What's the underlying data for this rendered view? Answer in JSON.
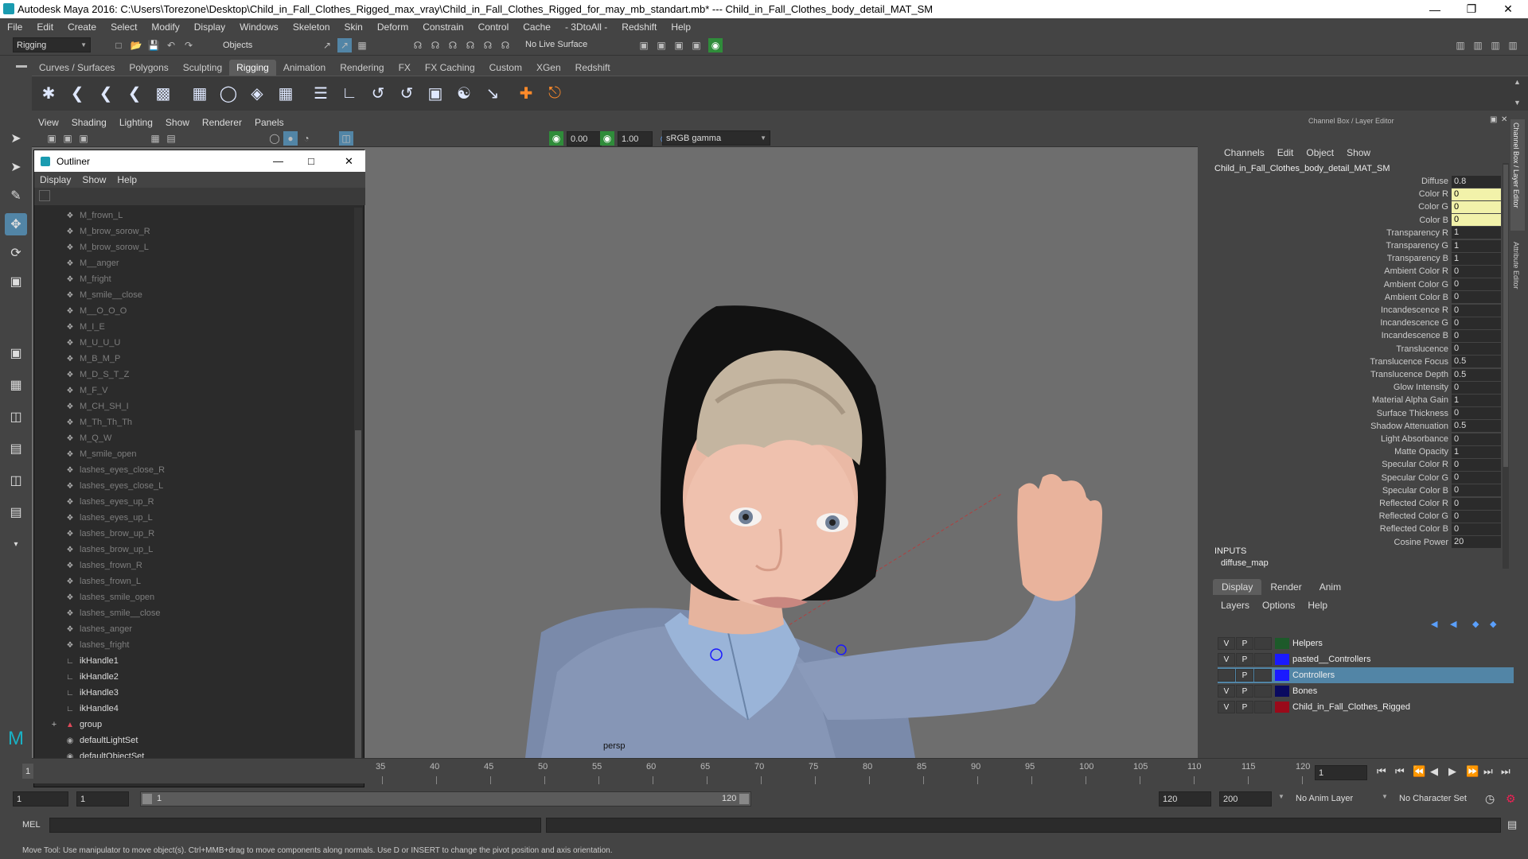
{
  "window": {
    "title": "Autodesk Maya 2016: C:\\Users\\Torezone\\Desktop\\Child_in_Fall_Clothes_Rigged_max_vray\\Child_in_Fall_Clothes_Rigged_for_may_mb_standart.mb*   ---   Child_in_Fall_Clothes_body_detail_MAT_SM"
  },
  "menubar": [
    "File",
    "Edit",
    "Create",
    "Select",
    "Modify",
    "Display",
    "Windows",
    "Skeleton",
    "Skin",
    "Deform",
    "Constrain",
    "Control",
    "Cache",
    "- 3DtoAll -",
    "Redshift",
    "Help"
  ],
  "statusline": {
    "menuset": "Rigging",
    "selmode": "Objects",
    "live_surface": "No Live Surface"
  },
  "shelf_tabs": [
    "Curves / Surfaces",
    "Polygons",
    "Sculpting",
    "Rigging",
    "Animation",
    "Rendering",
    "FX",
    "FX Caching",
    "Custom",
    "XGen",
    "Redshift"
  ],
  "shelf_active": "Rigging",
  "viewport": {
    "menu": [
      "View",
      "Shading",
      "Lighting",
      "Show",
      "Renderer",
      "Panels"
    ],
    "exposure": "0.00",
    "gamma": "1.00",
    "colorspace": "sRGB gamma",
    "camera_label": "persp"
  },
  "outliner": {
    "title": "Outliner",
    "menu": [
      "Display",
      "Show",
      "Help"
    ],
    "items": [
      {
        "label": "M_frown_L",
        "icon": "blendshape",
        "dim": true
      },
      {
        "label": "M_brow_sorow_R",
        "icon": "blendshape",
        "dim": true
      },
      {
        "label": "M_brow_sorow_L",
        "icon": "blendshape",
        "dim": true
      },
      {
        "label": "M__anger",
        "icon": "blendshape",
        "dim": true
      },
      {
        "label": "M_fright",
        "icon": "blendshape",
        "dim": true
      },
      {
        "label": "M_smile__close",
        "icon": "blendshape",
        "dim": true
      },
      {
        "label": "M__O_O_O",
        "icon": "blendshape",
        "dim": true
      },
      {
        "label": "M_I_E",
        "icon": "blendshape",
        "dim": true
      },
      {
        "label": "M_U_U_U",
        "icon": "blendshape",
        "dim": true
      },
      {
        "label": "M_B_M_P",
        "icon": "blendshape",
        "dim": true
      },
      {
        "label": "M_D_S_T_Z",
        "icon": "blendshape",
        "dim": true
      },
      {
        "label": "M_F_V",
        "icon": "blendshape",
        "dim": true
      },
      {
        "label": "M_CH_SH_I",
        "icon": "blendshape",
        "dim": true
      },
      {
        "label": "M_Th_Th_Th",
        "icon": "blendshape",
        "dim": true
      },
      {
        "label": "M_Q_W",
        "icon": "blendshape",
        "dim": true
      },
      {
        "label": "M_smile_open",
        "icon": "blendshape",
        "dim": true
      },
      {
        "label": "lashes_eyes_close_R",
        "icon": "blendshape",
        "dim": true
      },
      {
        "label": "lashes_eyes_close_L",
        "icon": "blendshape",
        "dim": true
      },
      {
        "label": "lashes_eyes_up_R",
        "icon": "blendshape",
        "dim": true
      },
      {
        "label": "lashes_eyes_up_L",
        "icon": "blendshape",
        "dim": true
      },
      {
        "label": "lashes_brow_up_R",
        "icon": "blendshape",
        "dim": true
      },
      {
        "label": "lashes_brow_up_L",
        "icon": "blendshape",
        "dim": true
      },
      {
        "label": "lashes_frown_R",
        "icon": "blendshape",
        "dim": true
      },
      {
        "label": "lashes_frown_L",
        "icon": "blendshape",
        "dim": true
      },
      {
        "label": "lashes_smile_open",
        "icon": "blendshape",
        "dim": true
      },
      {
        "label": "lashes_smile__close",
        "icon": "blendshape",
        "dim": true
      },
      {
        "label": "lashes_anger",
        "icon": "blendshape",
        "dim": true
      },
      {
        "label": "lashes_fright",
        "icon": "blendshape",
        "dim": true
      },
      {
        "label": "ikHandle1",
        "icon": "ikhandle",
        "dim": false
      },
      {
        "label": "ikHandle2",
        "icon": "ikhandle",
        "dim": false
      },
      {
        "label": "ikHandle3",
        "icon": "ikhandle",
        "dim": false
      },
      {
        "label": "ikHandle4",
        "icon": "ikhandle",
        "dim": false
      },
      {
        "label": "group",
        "icon": "group",
        "dim": false,
        "expandable": true
      },
      {
        "label": "defaultLightSet",
        "icon": "set",
        "dim": false
      },
      {
        "label": "defaultObjectSet",
        "icon": "set",
        "dim": false
      }
    ]
  },
  "channelbox": {
    "header": "Channel Box / Layer Editor",
    "menu": [
      "Channels",
      "Edit",
      "Object",
      "Show"
    ],
    "node": "Child_in_Fall_Clothes_body_detail_MAT_SM",
    "attributes": [
      {
        "name": "Diffuse",
        "value": "0.8",
        "hi": false
      },
      {
        "name": "Color R",
        "value": "0",
        "hi": true
      },
      {
        "name": "Color G",
        "value": "0",
        "hi": true
      },
      {
        "name": "Color B",
        "value": "0",
        "hi": true
      },
      {
        "name": "Transparency R",
        "value": "1",
        "hi": false
      },
      {
        "name": "Transparency G",
        "value": "1",
        "hi": false
      },
      {
        "name": "Transparency B",
        "value": "1",
        "hi": false
      },
      {
        "name": "Ambient Color R",
        "value": "0",
        "hi": false
      },
      {
        "name": "Ambient Color G",
        "value": "0",
        "hi": false
      },
      {
        "name": "Ambient Color B",
        "value": "0",
        "hi": false
      },
      {
        "name": "Incandescence R",
        "value": "0",
        "hi": false
      },
      {
        "name": "Incandescence G",
        "value": "0",
        "hi": false
      },
      {
        "name": "Incandescence B",
        "value": "0",
        "hi": false
      },
      {
        "name": "Translucence",
        "value": "0",
        "hi": false
      },
      {
        "name": "Translucence Focus",
        "value": "0.5",
        "hi": false
      },
      {
        "name": "Translucence Depth",
        "value": "0.5",
        "hi": false
      },
      {
        "name": "Glow Intensity",
        "value": "0",
        "hi": false
      },
      {
        "name": "Material Alpha Gain",
        "value": "1",
        "hi": false
      },
      {
        "name": "Surface Thickness",
        "value": "0",
        "hi": false
      },
      {
        "name": "Shadow Attenuation",
        "value": "0.5",
        "hi": false
      },
      {
        "name": "Light Absorbance",
        "value": "0",
        "hi": false
      },
      {
        "name": "Matte Opacity",
        "value": "1",
        "hi": false
      },
      {
        "name": "Specular Color R",
        "value": "0",
        "hi": false
      },
      {
        "name": "Specular Color G",
        "value": "0",
        "hi": false
      },
      {
        "name": "Specular Color B",
        "value": "0",
        "hi": false
      },
      {
        "name": "Reflected Color R",
        "value": "0",
        "hi": false
      },
      {
        "name": "Reflected Color G",
        "value": "0",
        "hi": false
      },
      {
        "name": "Reflected Color B",
        "value": "0",
        "hi": false
      },
      {
        "name": "Cosine Power",
        "value": "20",
        "hi": false
      }
    ],
    "inputs_label": "INPUTS",
    "inputs_item": "diffuse_map",
    "layer_tabs": [
      "Display",
      "Render",
      "Anim"
    ],
    "layer_menu": [
      "Layers",
      "Options",
      "Help"
    ],
    "layers": [
      {
        "v": "V",
        "p": "P",
        "name": "Helpers",
        "color": "#1d5a2a",
        "selected": false
      },
      {
        "v": "V",
        "p": "P",
        "name": "pasted__Controllers",
        "color": "#1a1aff",
        "selected": false
      },
      {
        "v": "",
        "p": "P",
        "name": "Controllers",
        "color": "#1a1aff",
        "selected": true
      },
      {
        "v": "V",
        "p": "P",
        "name": "Bones",
        "color": "#0a0a60",
        "selected": false
      },
      {
        "v": "V",
        "p": "P",
        "name": "Child_in_Fall_Clothes_Rigged",
        "color": "#9a0a1a",
        "selected": false
      }
    ],
    "side_tabs": [
      "Channel Box / Layer Editor",
      "Attribute Editor"
    ]
  },
  "timeline": {
    "ticks": [
      "35",
      "40",
      "45",
      "50",
      "55",
      "60",
      "65",
      "70",
      "75",
      "80",
      "85",
      "90",
      "95",
      "100",
      "105",
      "110",
      "115",
      "120"
    ],
    "current_frame": "1"
  },
  "range": {
    "start": "1",
    "start2": "1",
    "slider_start": "1",
    "slider_end": "120",
    "end": "120",
    "end2": "200",
    "anim_layer": "No Anim Layer",
    "char_set": "No Character Set"
  },
  "cmdline": {
    "label": "MEL"
  },
  "helpline": "Move Tool: Use manipulator to move object(s). Ctrl+MMB+drag to move components along normals. Use D or INSERT to change the pivot position and axis orientation.",
  "colors": {
    "accent": "#5285a6",
    "bg": "#444444",
    "viewport": "#6e6e6e"
  }
}
